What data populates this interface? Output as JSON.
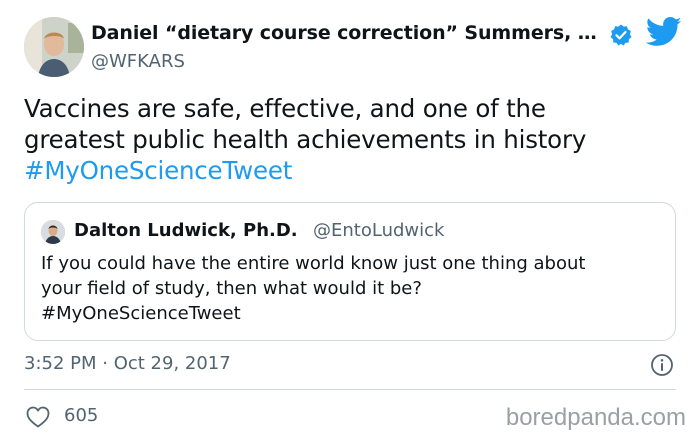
{
  "tweet": {
    "author": {
      "name": "Daniel “dietary course correction” Summers, …",
      "handle": "@WFKARS",
      "verified": true
    },
    "text_lines": [
      "Vaccines are safe, effective, and one of the",
      "greatest public health achievements in history"
    ],
    "hashtag": "#MyOneScienceTweet",
    "quoted": {
      "name": "Dalton Ludwick, Ph.D.",
      "handle": "@EntoLudwick",
      "lines": [
        "If you could have the entire world know just one thing about",
        "your field of study, then what would it be?",
        "#MyOneScienceTweet"
      ]
    },
    "timestamp": "3:52 PM · Oct 29, 2017",
    "likes": "605"
  },
  "watermark": "boredpanda.com",
  "icons": {
    "verified": "verified-badge-icon",
    "bird": "twitter-bird-icon",
    "info": "info-icon",
    "like": "heart-icon"
  },
  "colors": {
    "accent": "#1d9bf0",
    "muted": "#536471",
    "border": "#cfd9de"
  }
}
